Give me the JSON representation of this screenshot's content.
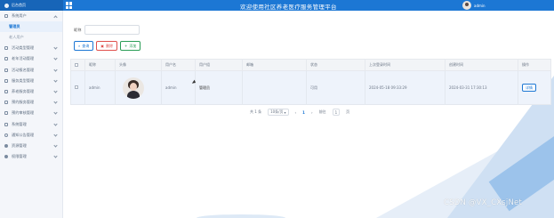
{
  "header": {
    "brand_label": "后台首页",
    "title": "欢迎使用社区养老医疗服务管理平台",
    "username": "admin"
  },
  "sidebar": {
    "items": [
      {
        "label": "系统用户",
        "icon": "user-icon",
        "open": true,
        "children": [
          {
            "label": "管理员",
            "active": true
          },
          {
            "label": "老人用户",
            "active": false
          }
        ]
      },
      {
        "label": "活动类型管理",
        "icon": "folder-icon"
      },
      {
        "label": "老年活动管理",
        "icon": "folder-icon"
      },
      {
        "label": "活动报名管理",
        "icon": "folder-icon"
      },
      {
        "label": "服务类型管理",
        "icon": "folder-icon"
      },
      {
        "label": "养老服务管理",
        "icon": "folder-icon"
      },
      {
        "label": "预约服务管理",
        "icon": "folder-icon"
      },
      {
        "label": "预约审核管理",
        "icon": "folder-icon"
      },
      {
        "label": "系统管理",
        "icon": "gear-icon"
      },
      {
        "label": "通知公告管理",
        "icon": "clock-icon"
      },
      {
        "label": "资源管理",
        "icon": "shield-icon"
      },
      {
        "label": "权限管理",
        "icon": "user-icon"
      }
    ]
  },
  "filter": {
    "label": "昵称",
    "value": "",
    "placeholder": ""
  },
  "buttons": {
    "search": "查询",
    "delete": "删除",
    "add": "添加"
  },
  "table": {
    "headers": [
      "",
      "昵称",
      "头像",
      "用户名",
      "用户组",
      "邮箱",
      "状态",
      "上次登录时间",
      "创建时间",
      "操作"
    ],
    "rows": [
      {
        "nickname": "admin",
        "username": "admin",
        "group": "管理员",
        "email": "",
        "status": "可用",
        "last_login": "2024-05-18 09:33:29",
        "created": "2024-03-31 17:30:13",
        "action": "详情"
      }
    ]
  },
  "pagination": {
    "total": "共 1 条",
    "page_size": "10条/页",
    "prev": "‹",
    "page": "1",
    "next": "›",
    "goto_label": "前往",
    "goto_value": "1",
    "goto_suffix": "页"
  },
  "watermark": "CSDN @VX_CXsjNet",
  "colors": {
    "primary": "#1c77d4",
    "danger": "#e0504c",
    "success": "#2a9d56"
  }
}
